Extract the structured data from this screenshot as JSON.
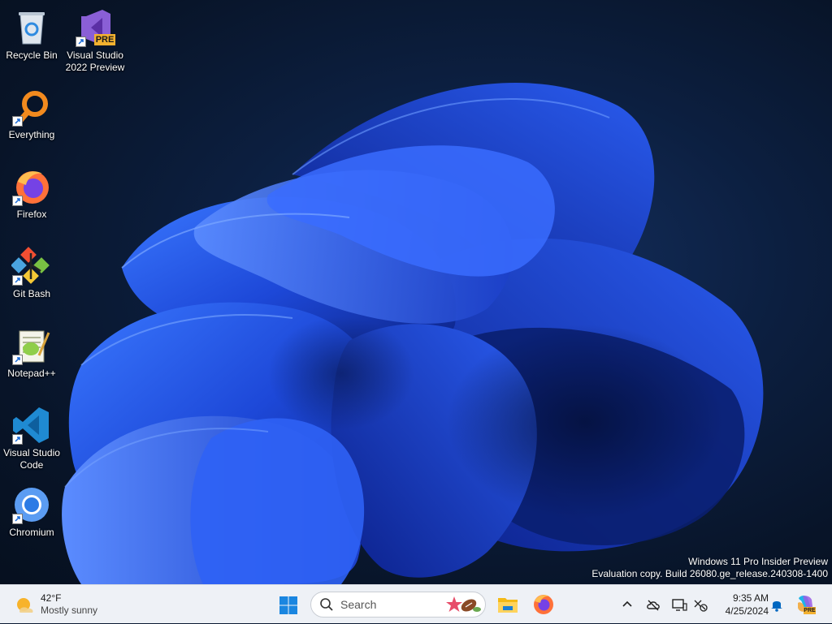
{
  "desktop": {
    "icons": [
      {
        "label": "Recycle Bin",
        "icon": "recycle-bin-icon"
      },
      {
        "label": "Visual Studio\n2022 Preview",
        "icon": "visual-studio-preview-icon",
        "badge": "PRE"
      },
      {
        "label": "Everything",
        "icon": "everything-search-icon"
      },
      {
        "label": "Firefox",
        "icon": "firefox-icon"
      },
      {
        "label": "Git Bash",
        "icon": "git-bash-icon"
      },
      {
        "label": "Notepad++",
        "icon": "notepad-plus-plus-icon"
      },
      {
        "label": "Visual Studio\nCode",
        "icon": "vscode-icon"
      },
      {
        "label": "Chromium",
        "icon": "chromium-icon"
      }
    ],
    "watermark": {
      "line1": "Windows 11 Pro Insider Preview",
      "line2": "Evaluation copy. Build 26080.ge_release.240308-1400"
    }
  },
  "taskbar": {
    "weather": {
      "temperature": "42°F",
      "condition": "Mostly sunny",
      "icon": "sun-cloud-icon"
    },
    "search": {
      "placeholder": "Search"
    },
    "pinned": [
      {
        "name": "start",
        "icon": "windows-start-icon"
      },
      {
        "name": "file-explorer",
        "icon": "file-explorer-icon"
      },
      {
        "name": "firefox",
        "icon": "firefox-icon"
      }
    ],
    "tray": {
      "icons": [
        "chevron-up-icon",
        "onedrive-offline-icon",
        "display-icon",
        "network-disconnected-icon",
        "notification-bell-icon",
        "copilot-icon"
      ],
      "copilot_badge": "PRE"
    },
    "clock": {
      "time": "9:35 AM",
      "date": "4/25/2024"
    }
  },
  "colors": {
    "wallpaper_bg": "#0b1a33",
    "bloom_blue": "#1f4fe0",
    "taskbar_bg": "#eef1f6",
    "accent": "#0067c0"
  }
}
